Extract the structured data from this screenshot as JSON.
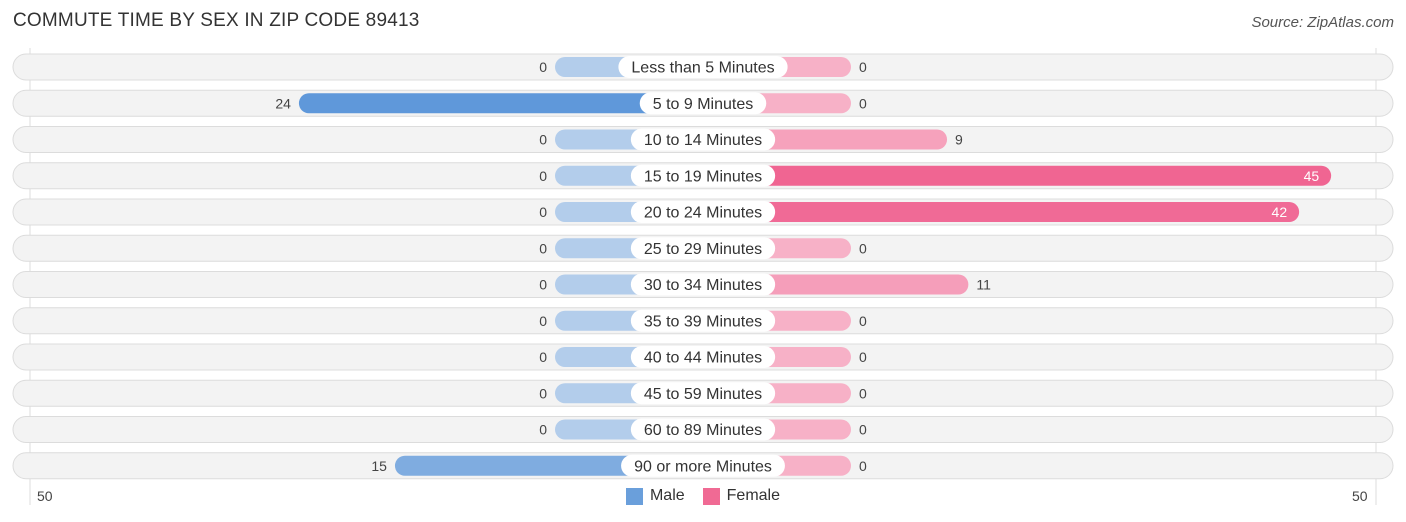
{
  "title": "COMMUTE TIME BY SEX IN ZIP CODE 89413",
  "source": "Source: ZipAtlas.com",
  "legend": [
    {
      "name": "Male",
      "color": "#6a9fdb"
    },
    {
      "name": "Female",
      "color": "#f06a94"
    }
  ],
  "axis": {
    "left_label": "50",
    "right_label": "50"
  },
  "chart_data": {
    "type": "bar",
    "orientation": "horizontal-diverging",
    "title": "COMMUTE TIME BY SEX IN ZIP CODE 89413",
    "categories": [
      "Less than 5 Minutes",
      "5 to 9 Minutes",
      "10 to 14 Minutes",
      "15 to 19 Minutes",
      "20 to 24 Minutes",
      "25 to 29 Minutes",
      "30 to 34 Minutes",
      "35 to 39 Minutes",
      "40 to 44 Minutes",
      "45 to 59 Minutes",
      "60 to 89 Minutes",
      "90 or more Minutes"
    ],
    "series": [
      {
        "name": "Male",
        "values": [
          0,
          24,
          0,
          0,
          0,
          0,
          0,
          0,
          0,
          0,
          0,
          15
        ]
      },
      {
        "name": "Female",
        "values": [
          0,
          0,
          9,
          45,
          42,
          0,
          11,
          0,
          0,
          0,
          0,
          0
        ]
      }
    ],
    "xlim": [
      -50,
      50
    ],
    "tick_labels": [
      "50",
      "50"
    ],
    "legend_position": "bottom-center"
  }
}
